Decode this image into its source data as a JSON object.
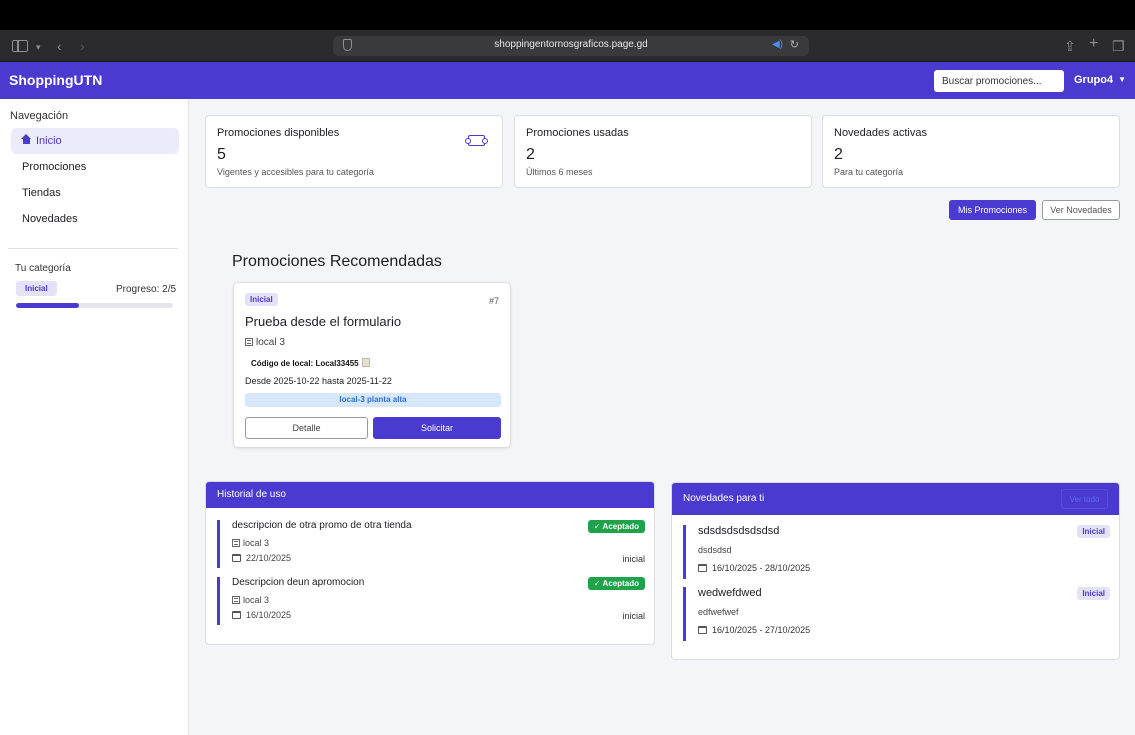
{
  "browser": {
    "url": "shoppingentornosgraficos.page.gd"
  },
  "header": {
    "brand": "ShoppingUTN",
    "search_placeholder": "Buscar promociones...",
    "user": "Grupo4"
  },
  "sidebar": {
    "nav_title": "Navegación",
    "items": [
      {
        "label": "Inicio",
        "active": true
      },
      {
        "label": "Promociones"
      },
      {
        "label": "Tiendas"
      },
      {
        "label": "Novedades"
      }
    ],
    "category_label": "Tu categoría",
    "category": "Inicial",
    "progress_text": "Progreso: 2/5",
    "progress_fraction": 0.4
  },
  "stats": [
    {
      "title": "Promociones disponibles",
      "value": "5",
      "sub": "Vigentes y accesibles para tu categoría",
      "icon": "ticket-icon"
    },
    {
      "title": "Promociones usadas",
      "value": "2",
      "sub": "Últimos 6 meses"
    },
    {
      "title": "Novedades activas",
      "value": "2",
      "sub": "Para tu categoría"
    }
  ],
  "actions": {
    "my_promos": "Mis Promociones",
    "see_news": "Ver Novedades"
  },
  "recommended": {
    "title": "Promociones Recomendadas",
    "card": {
      "badge": "Inicial",
      "id": "#7",
      "title": "Prueba desde el formulario",
      "local": "local 3",
      "code": "Código de local: Local33455",
      "dates": "Desde 2025-10-22 hasta 2025-11-22",
      "location": "local-3 planta alta",
      "detail_btn": "Detalle",
      "request_btn": "Solicitar"
    }
  },
  "history": {
    "title": "Historial de uso",
    "items": [
      {
        "desc": "descripcion de otra promo de otra tienda",
        "local": "local 3",
        "date": "22/10/2025",
        "status": "✓ Aceptado",
        "category": "inicial"
      },
      {
        "desc": "Descripcion deun apromocion",
        "local": "local 3",
        "date": "16/10/2025",
        "status": "✓ Aceptado",
        "category": "inicial"
      }
    ]
  },
  "news": {
    "title": "Novedades para ti",
    "see_all": "Ver todo",
    "items": [
      {
        "title": "sdsdsdsdsdsdsd",
        "desc": "dsdsdsd",
        "dates": "16/10/2025 - 28/10/2025",
        "badge": "Inicial"
      },
      {
        "title": "wedwefdwed",
        "desc": "edfwefwef",
        "dates": "16/10/2025 - 27/10/2025",
        "badge": "Inicial"
      }
    ]
  },
  "colors": {
    "primary": "#4a3ad0",
    "success": "#1fa34a",
    "info_bg": "#d6e6fb"
  }
}
